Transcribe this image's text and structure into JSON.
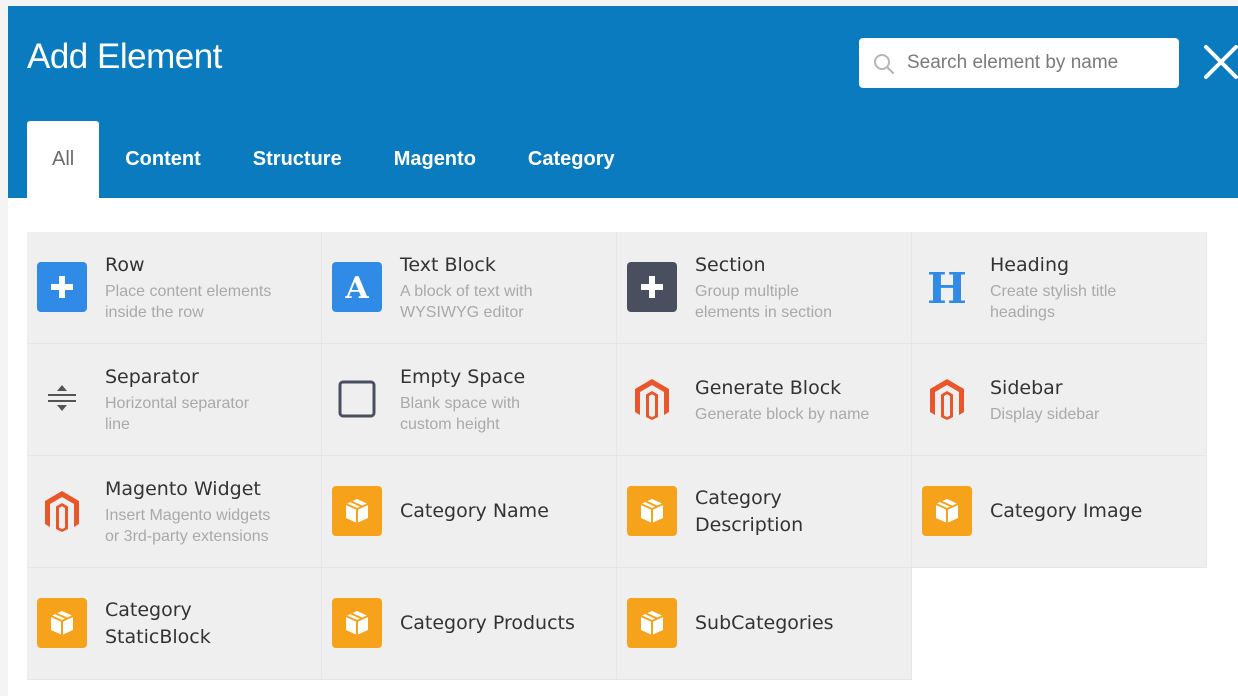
{
  "title": "Add Element",
  "search": {
    "placeholder": "Search element by name",
    "icon": "search-icon"
  },
  "close_icon": "close-icon",
  "tabs": [
    {
      "label": "All",
      "active": true
    },
    {
      "label": "Content",
      "active": false
    },
    {
      "label": "Structure",
      "active": false
    },
    {
      "label": "Magento",
      "active": false
    },
    {
      "label": "Category",
      "active": false
    }
  ],
  "colors": {
    "header": "#0a7bbf",
    "accent_blue": "#2f8be6",
    "dark_slate": "#4a4f60",
    "magento_orange": "#e8562a",
    "category_orange": "#f7a21b",
    "heading_blue": "#2f8be6"
  },
  "elements": [
    {
      "name": "Row",
      "desc1": "Place content elements",
      "desc2": "inside the row",
      "icon": "plus-icon"
    },
    {
      "name": "Text Block",
      "desc1": "A block of text with",
      "desc2": "WYSIWYG editor",
      "icon": "text-a-icon"
    },
    {
      "name": "Section",
      "desc1": "Group multiple",
      "desc2": "elements in section",
      "icon": "plus-dark-icon"
    },
    {
      "name": "Heading",
      "desc1": "Create stylish title",
      "desc2": "headings",
      "icon": "heading-h-icon"
    },
    {
      "name": "Separator",
      "desc1": "Horizontal separator",
      "desc2": "line",
      "icon": "separator-icon"
    },
    {
      "name": "Empty Space",
      "desc1": "Blank space with",
      "desc2": "custom height",
      "icon": "empty-square-icon"
    },
    {
      "name": "Generate Block",
      "desc1": "Generate block by name",
      "desc2": "",
      "icon": "magento-logo-icon"
    },
    {
      "name": "Sidebar",
      "desc1": "Display sidebar",
      "desc2": "",
      "icon": "magento-logo-icon"
    },
    {
      "name": "Magento Widget",
      "desc1": "Insert Magento widgets",
      "desc2": "or 3rd-party extensions",
      "icon": "magento-logo-icon"
    },
    {
      "name": "Category Name",
      "desc1": "",
      "desc2": "",
      "icon": "category-box-icon"
    },
    {
      "name": "Category Description",
      "desc1": "",
      "desc2": "",
      "icon": "category-box-icon"
    },
    {
      "name": "Category Image",
      "desc1": "",
      "desc2": "",
      "icon": "category-box-icon"
    },
    {
      "name": "Category StaticBlock",
      "desc1": "",
      "desc2": "",
      "icon": "category-box-icon"
    },
    {
      "name": "Category Products",
      "desc1": "",
      "desc2": "",
      "icon": "category-box-icon"
    },
    {
      "name": "SubCategories",
      "desc1": "",
      "desc2": "",
      "icon": "category-box-icon"
    }
  ],
  "element_names_wrapped": {
    "Category Description": [
      "Category",
      "Description"
    ],
    "Category StaticBlock": [
      "Category",
      "StaticBlock"
    ]
  }
}
